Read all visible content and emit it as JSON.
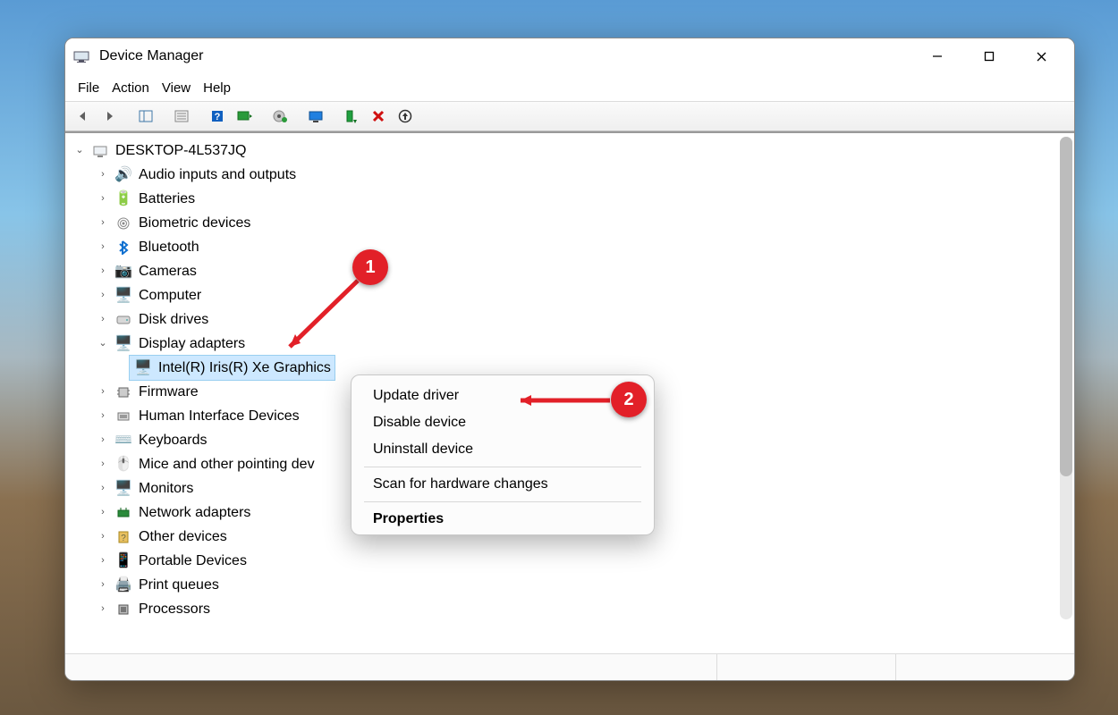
{
  "window": {
    "title": "Device Manager"
  },
  "menu": {
    "file": "File",
    "action": "Action",
    "view": "View",
    "help": "Help"
  },
  "tree": {
    "root": "DESKTOP-4L537JQ",
    "items": [
      "Audio inputs and outputs",
      "Batteries",
      "Biometric devices",
      "Bluetooth",
      "Cameras",
      "Computer",
      "Disk drives",
      "Display adapters",
      "Firmware",
      "Human Interface Devices",
      "Keyboards",
      "Mice and other pointing dev",
      "Monitors",
      "Network adapters",
      "Other devices",
      "Portable Devices",
      "Print queues",
      "Processors"
    ],
    "display_child": "Intel(R) Iris(R) Xe Graphics"
  },
  "context": {
    "update": "Update driver",
    "disable": "Disable device",
    "uninstall": "Uninstall device",
    "scan": "Scan for hardware changes",
    "properties": "Properties"
  },
  "callouts": {
    "one": "1",
    "two": "2"
  }
}
